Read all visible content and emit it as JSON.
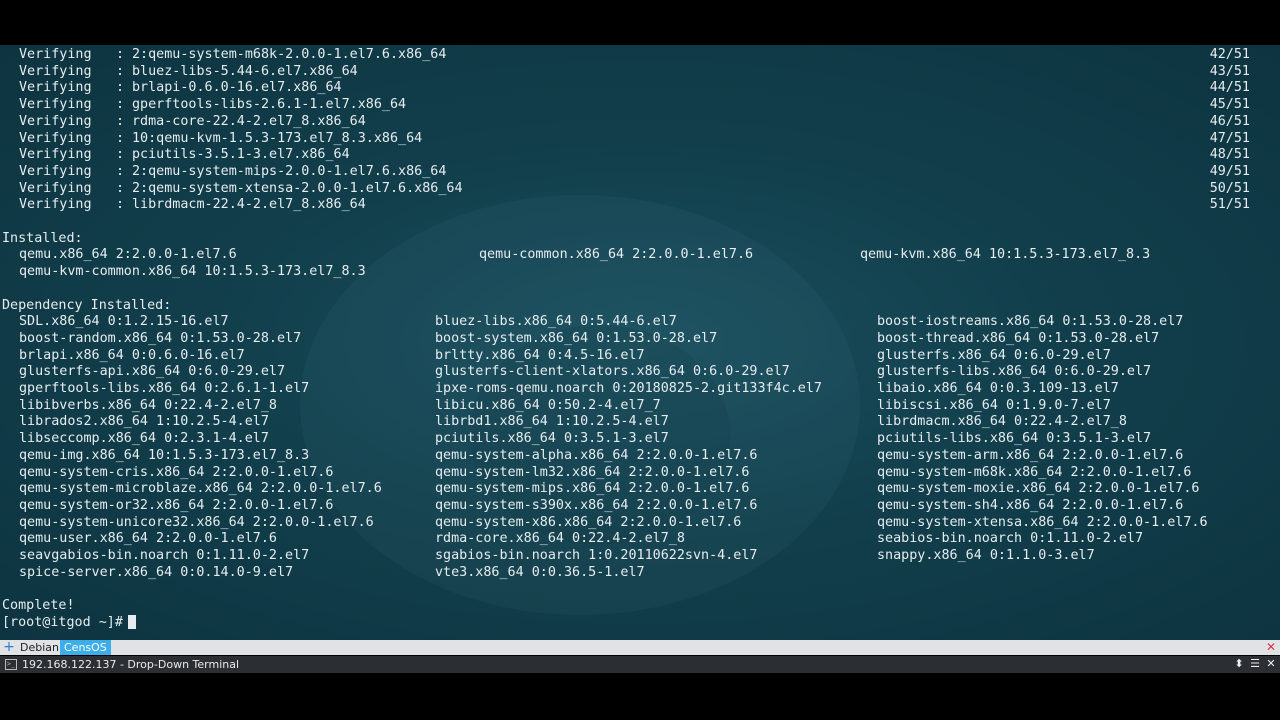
{
  "terminal": {
    "verify_lines": [
      {
        "label": "Verifying",
        "pkg": "2:qemu-system-m68k-2.0.0-1.el7.6.x86_64",
        "count": "42/51"
      },
      {
        "label": "Verifying",
        "pkg": "bluez-libs-5.44-6.el7.x86_64",
        "count": "43/51"
      },
      {
        "label": "Verifying",
        "pkg": "brlapi-0.6.0-16.el7.x86_64",
        "count": "44/51"
      },
      {
        "label": "Verifying",
        "pkg": "gperftools-libs-2.6.1-1.el7.x86_64",
        "count": "45/51"
      },
      {
        "label": "Verifying",
        "pkg": "rdma-core-22.4-2.el7_8.x86_64",
        "count": "46/51"
      },
      {
        "label": "Verifying",
        "pkg": "10:qemu-kvm-1.5.3-173.el7_8.3.x86_64",
        "count": "47/51"
      },
      {
        "label": "Verifying",
        "pkg": "pciutils-3.5.1-3.el7.x86_64",
        "count": "48/51"
      },
      {
        "label": "Verifying",
        "pkg": "2:qemu-system-mips-2.0.0-1.el7.6.x86_64",
        "count": "49/51"
      },
      {
        "label": "Verifying",
        "pkg": "2:qemu-system-xtensa-2.0.0-1.el7.6.x86_64",
        "count": "50/51"
      },
      {
        "label": "Verifying",
        "pkg": "librdmacm-22.4-2.el7_8.x86_64",
        "count": "51/51"
      }
    ],
    "installed_header": "Installed:",
    "installed": [
      [
        "qemu.x86_64 2:2.0.0-1.el7.6",
        "qemu-common.x86_64 2:2.0.0-1.el7.6",
        "qemu-kvm.x86_64 10:1.5.3-173.el7_8.3"
      ],
      [
        "qemu-kvm-common.x86_64 10:1.5.3-173.el7_8.3",
        "",
        ""
      ]
    ],
    "dependency_header": "Dependency Installed:",
    "dependencies": [
      [
        "SDL.x86_64 0:1.2.15-16.el7",
        "bluez-libs.x86_64 0:5.44-6.el7",
        "boost-iostreams.x86_64 0:1.53.0-28.el7"
      ],
      [
        "boost-random.x86_64 0:1.53.0-28.el7",
        "boost-system.x86_64 0:1.53.0-28.el7",
        "boost-thread.x86_64 0:1.53.0-28.el7"
      ],
      [
        "brlapi.x86_64 0:0.6.0-16.el7",
        "brltty.x86_64 0:4.5-16.el7",
        "glusterfs.x86_64 0:6.0-29.el7"
      ],
      [
        "glusterfs-api.x86_64 0:6.0-29.el7",
        "glusterfs-client-xlators.x86_64 0:6.0-29.el7",
        "glusterfs-libs.x86_64 0:6.0-29.el7"
      ],
      [
        "gperftools-libs.x86_64 0:2.6.1-1.el7",
        "ipxe-roms-qemu.noarch 0:20180825-2.git133f4c.el7",
        "libaio.x86_64 0:0.3.109-13.el7"
      ],
      [
        "libibverbs.x86_64 0:22.4-2.el7_8",
        "libicu.x86_64 0:50.2-4.el7_7",
        "libiscsi.x86_64 0:1.9.0-7.el7"
      ],
      [
        "librados2.x86_64 1:10.2.5-4.el7",
        "librbd1.x86_64 1:10.2.5-4.el7",
        "librdmacm.x86_64 0:22.4-2.el7_8"
      ],
      [
        "libseccomp.x86_64 0:2.3.1-4.el7",
        "pciutils.x86_64 0:3.5.1-3.el7",
        "pciutils-libs.x86_64 0:3.5.1-3.el7"
      ],
      [
        "qemu-img.x86_64 10:1.5.3-173.el7_8.3",
        "qemu-system-alpha.x86_64 2:2.0.0-1.el7.6",
        "qemu-system-arm.x86_64 2:2.0.0-1.el7.6"
      ],
      [
        "qemu-system-cris.x86_64 2:2.0.0-1.el7.6",
        "qemu-system-lm32.x86_64 2:2.0.0-1.el7.6",
        "qemu-system-m68k.x86_64 2:2.0.0-1.el7.6"
      ],
      [
        "qemu-system-microblaze.x86_64 2:2.0.0-1.el7.6",
        "qemu-system-mips.x86_64 2:2.0.0-1.el7.6",
        "qemu-system-moxie.x86_64 2:2.0.0-1.el7.6"
      ],
      [
        "qemu-system-or32.x86_64 2:2.0.0-1.el7.6",
        "qemu-system-s390x.x86_64 2:2.0.0-1.el7.6",
        "qemu-system-sh4.x86_64 2:2.0.0-1.el7.6"
      ],
      [
        "qemu-system-unicore32.x86_64 2:2.0.0-1.el7.6",
        "qemu-system-x86.x86_64 2:2.0.0-1.el7.6",
        "qemu-system-xtensa.x86_64 2:2.0.0-1.el7.6"
      ],
      [
        "qemu-user.x86_64 2:2.0.0-1.el7.6",
        "rdma-core.x86_64 0:22.4-2.el7_8",
        "seabios-bin.noarch 0:1.11.0-2.el7"
      ],
      [
        "seavgabios-bin.noarch 0:1.11.0-2.el7",
        "sgabios-bin.noarch 1:0.20110622svn-4.el7",
        "snappy.x86_64 0:1.1.0-3.el7"
      ],
      [
        "spice-server.x86_64 0:0.14.0-9.el7",
        "vte3.x86_64 0:0.36.5-1.el7",
        ""
      ]
    ],
    "complete": "Complete!",
    "prompt": "[root@itgod ~]#"
  },
  "tabbar": {
    "add_icon": "plus-icon",
    "tabs": [
      {
        "label": "Debian",
        "active": false
      },
      {
        "label": "CensOS",
        "active": true
      }
    ],
    "close_icon": "close-icon"
  },
  "titlebar": {
    "title": "192.168.122.137 - Drop-Down Terminal",
    "icons": [
      "terminal-icon",
      "pin-icon",
      "menu-icon",
      "close-icon"
    ]
  },
  "colors": {
    "terminal_bg": "#123f4c",
    "text": "#e6ecef",
    "active_tab": "#3daee9",
    "tab_close": "#d9334a",
    "titlebar_bg": "#2b2f33"
  }
}
